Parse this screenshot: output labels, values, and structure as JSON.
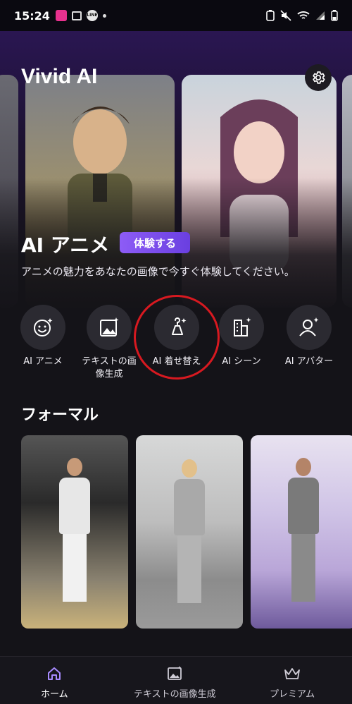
{
  "status_bar": {
    "time": "15:24",
    "line_icon_text": "LINE",
    "icons": [
      "app-notification-icon",
      "gallery-icon",
      "line-icon",
      "dot-icon",
      "battery-saver-icon",
      "mute-icon",
      "wifi-icon",
      "signal-icon",
      "battery-icon"
    ]
  },
  "header": {
    "app_title": "Vivid AI",
    "settings_icon": "gear-icon"
  },
  "hero": {
    "heading": "AI アニメ",
    "badge": "体験する",
    "description": "アニメの魅力をあなたの画像で今すぐ体験してください。"
  },
  "quick_actions": [
    {
      "label": "AI アニメ",
      "icon": "smile-sparkle-icon"
    },
    {
      "label": "テキストの画\n像生成",
      "icon": "image-sparkle-icon"
    },
    {
      "label": "AI 着せ替え",
      "icon": "hanger-sparkle-icon"
    },
    {
      "label": "AI シーン",
      "icon": "building-sparkle-icon"
    },
    {
      "label": "AI アバター",
      "icon": "person-sparkle-icon"
    }
  ],
  "formal": {
    "title": "フォーマル"
  },
  "bottom_nav": [
    {
      "label": "ホーム",
      "icon": "home-icon",
      "active": true
    },
    {
      "label": "テキストの画像生成",
      "icon": "image-icon",
      "active": false
    },
    {
      "label": "プレミアム",
      "icon": "crown-icon",
      "active": false
    }
  ],
  "colors": {
    "accent": "#8d5cf6",
    "highlight_ring": "#d71920",
    "nav_active": "#a88bff"
  }
}
